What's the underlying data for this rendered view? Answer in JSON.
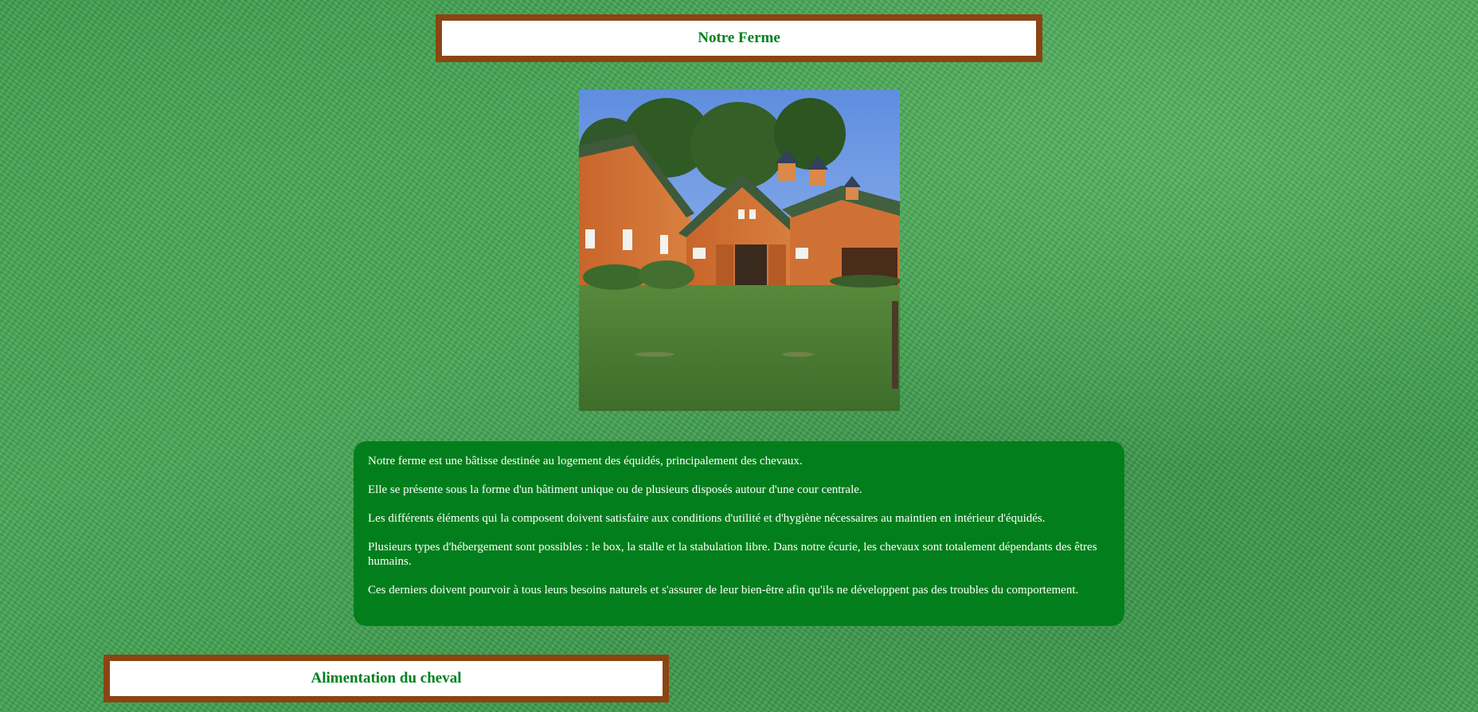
{
  "header": {
    "title": "Notre Ferme"
  },
  "image": {
    "subject": "barn-photo"
  },
  "content": {
    "paragraphs": [
      "Notre ferme est une bâtisse destinée au logement des équidés, principalement des chevaux.",
      "Elle se présente sous la forme d'un bâtiment unique ou de plusieurs disposés autour d'une cour centrale.",
      "Les différents éléments qui la composent doivent satisfaire aux conditions d'utilité et d'hygiène nécessaires au maintien en intérieur d'équidés.",
      "Plusieurs types d'hébergement sont possibles : le box, la stalle et la stabulation libre. Dans notre écurie, les chevaux sont totalement dépendants des êtres humains.",
      "Ces derniers doivent pourvoir à tous leurs besoins naturels et s'assurer de leur bien-être afin qu'ils ne développent pas des troubles du comportement."
    ]
  },
  "section": {
    "title": "Alimentation du cheval"
  },
  "colors": {
    "title_border": "#8b4513",
    "title_text": "#008020",
    "content_background": "#027f1c",
    "page_background": "#3f9d50"
  }
}
